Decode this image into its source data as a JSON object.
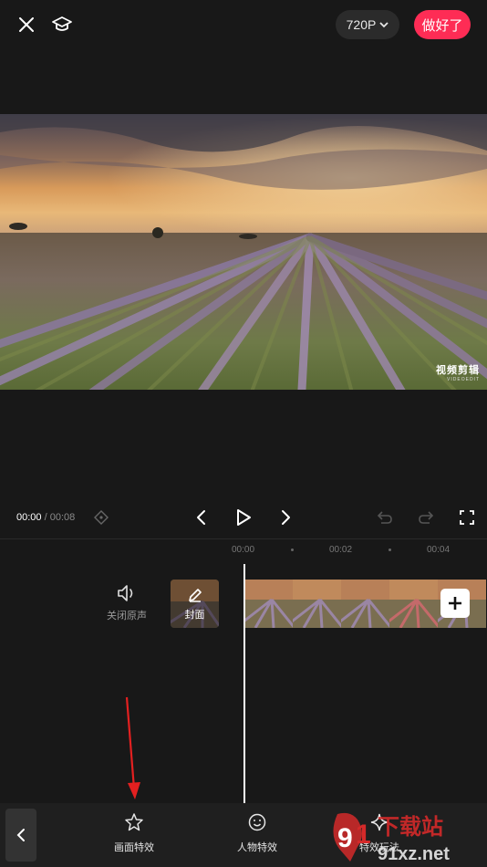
{
  "topbar": {
    "close_icon": "close-icon",
    "tutorial_icon": "graduation-cap-icon",
    "resolution_label": "720P",
    "done_label": "做好了"
  },
  "preview": {
    "watermark_main": "视频剪辑",
    "watermark_sub": "VIDEOEDIT"
  },
  "controls": {
    "current_time": "00:00",
    "separator": " / ",
    "total_time": "00:08"
  },
  "ruler": {
    "ticks": [
      "00:00",
      "00:02",
      "00:04"
    ]
  },
  "track": {
    "mute_label": "关闭原声",
    "cover_label": "封面",
    "add_icon": "plus-icon"
  },
  "bottom_toolbar": {
    "tools": [
      {
        "label": "画面特效",
        "icon": "sparkle-star-icon"
      },
      {
        "label": "人物特效",
        "icon": "smiley-icon"
      },
      {
        "label": "特效玩法",
        "icon": "sparkle-icon"
      }
    ]
  },
  "site_watermark": {
    "text_top": "下载站",
    "text_bottom": "91xz.net"
  },
  "colors": {
    "accent": "#fe2c55",
    "background": "#181818",
    "annotation_arrow": "#e32020"
  }
}
